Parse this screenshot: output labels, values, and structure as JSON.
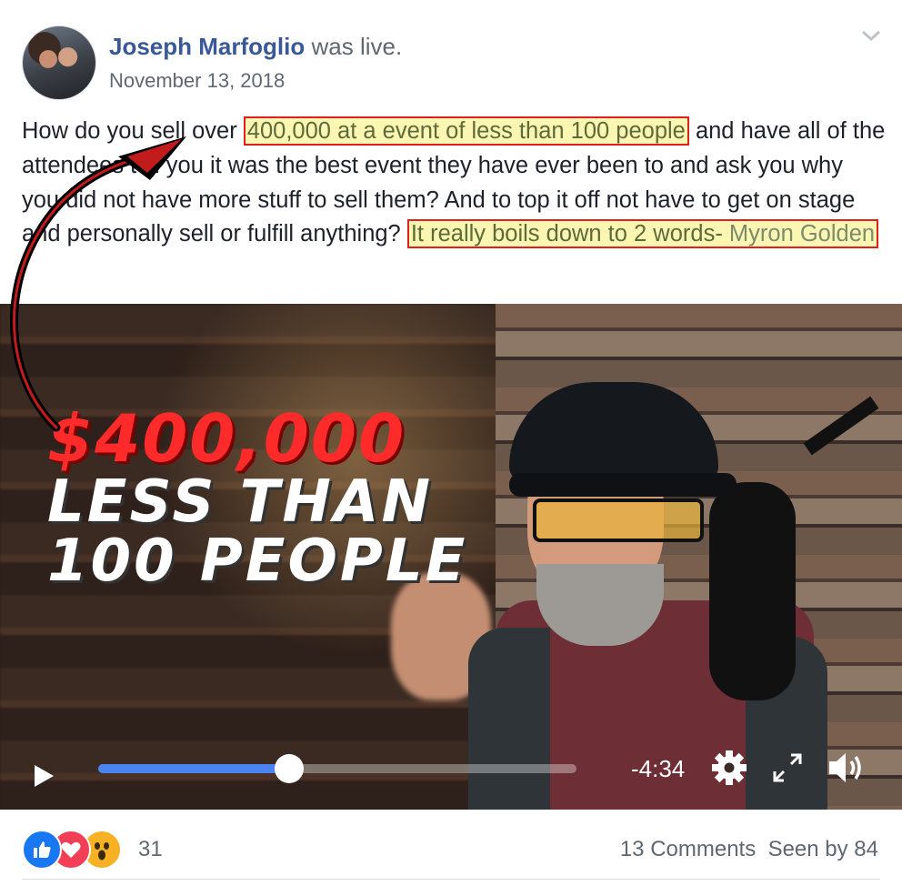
{
  "post": {
    "author": "Joseph Marfoglio",
    "author_verb": "was live.",
    "date": "November 13, 2018",
    "text_1": "How do you sell over ",
    "highlight_1": "400,000 at a event of less than 100 people",
    "text_2": " and have all of the attendees tell you it was the best event they have ever been to and ask you why you did not have more stuff to sell them? And to top it off not have to get on stage and personally sell or fulfill anything? ",
    "highlight_2_text": "It really boils down to 2 words- ",
    "highlight_2_link": "Myron Golden"
  },
  "video": {
    "overlay_line_1": "$400,000",
    "overlay_line_2": "LESS THAN",
    "overlay_line_3": "100 PEOPLE",
    "time_remaining": "-4:34",
    "progress_fraction": 0.4
  },
  "footer": {
    "reaction_count": "31",
    "comments": "13 Comments",
    "seen_by": "Seen by 84"
  },
  "icons": {
    "like": "like-icon",
    "love": "love-icon",
    "wow": "wow-icon",
    "play": "play-icon",
    "settings": "gear-icon",
    "expand": "expand-icon",
    "volume": "volume-icon",
    "options": "chevron-down-icon"
  },
  "colors": {
    "author": "#385898",
    "highlight_bg": "#fbf6b2",
    "highlight_border": "#e11f1f",
    "progress": "#4a84f0",
    "overlay_red": "#ff2a2a"
  }
}
